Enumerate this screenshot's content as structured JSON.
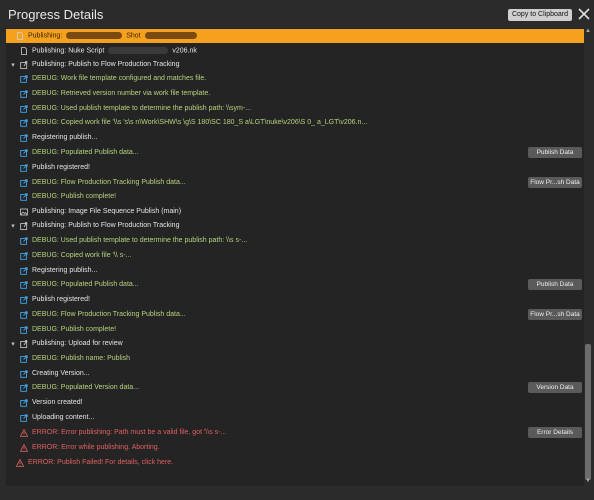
{
  "window": {
    "title": "Progress Details",
    "copy_label": "Copy to Clipboard"
  },
  "rows": [
    {
      "label": "Publishing:",
      "label2": "Shot",
      "style": "highlight",
      "icon": "doc-icon"
    },
    {
      "label": "Publishing: Nuke Script",
      "label2": "v206.nk",
      "style": "white",
      "icon": "doc-icon"
    },
    {
      "label": "Publishing: Publish to Flow Production Tracking",
      "style": "white",
      "icon": "upload-icon",
      "expand": "▾"
    },
    {
      "label": "DEBUG: Work file template configured and matches file.",
      "style": "green",
      "icon": "external-link-icon"
    },
    {
      "label": "DEBUG: Retrieved version number via work file template.",
      "style": "green",
      "icon": "external-link-icon"
    },
    {
      "label": "DEBUG: Used publish template to determine the publish path: \\\\sym-...",
      "style": "green",
      "icon": "external-link-icon"
    },
    {
      "label": "DEBUG: Copied work file '\\\\s    's\\s    n\\Work\\SHW\\s                    \\g\\S    180\\SC    180_S        a\\LGT\\nuke\\v206\\S    0_    a_LGT\\v206.n...",
      "style": "green",
      "icon": "external-link-icon"
    },
    {
      "label": "Registering publish...",
      "style": "white",
      "icon": "external-link-icon"
    },
    {
      "label": "DEBUG: Populated Publish data...",
      "style": "green",
      "icon": "external-link-icon",
      "button": "Publish Data"
    },
    {
      "label": "Publish registered!",
      "style": "white",
      "icon": "external-link-icon"
    },
    {
      "label": "DEBUG: Flow Production Tracking Publish data...",
      "style": "green",
      "icon": "external-link-icon",
      "button": "Flow Pr...sh Data"
    },
    {
      "label": "DEBUG: Publish complete!",
      "style": "green",
      "icon": "external-link-icon"
    },
    {
      "label": "Publishing: Image File Sequence Publish (main)",
      "style": "white",
      "icon": "image-icon"
    },
    {
      "label": "Publishing: Publish to Flow Production Tracking",
      "style": "white",
      "icon": "upload-icon",
      "expand": "▾"
    },
    {
      "label": "DEBUG: Used publish template to determine the publish path: \\\\s    s-...",
      "style": "green",
      "icon": "external-link-icon"
    },
    {
      "label": "DEBUG: Copied work file '\\\\     s-...",
      "style": "green",
      "icon": "external-link-icon"
    },
    {
      "label": "Registering publish...",
      "style": "white",
      "icon": "external-link-icon"
    },
    {
      "label": "DEBUG: Populated Publish data...",
      "style": "green",
      "icon": "external-link-icon",
      "button": "Publish Data"
    },
    {
      "label": "Publish registered!",
      "style": "white",
      "icon": "external-link-icon"
    },
    {
      "label": "DEBUG: Flow Production Tracking Publish data...",
      "style": "green",
      "icon": "external-link-icon",
      "button": "Flow Pr...sh Data"
    },
    {
      "label": "DEBUG: Publish complete!",
      "style": "green",
      "icon": "external-link-icon"
    },
    {
      "label": "Publishing: Upload for review",
      "style": "white",
      "icon": "upload-icon",
      "expand": "▾"
    },
    {
      "label": "DEBUG: Publish name: Publish",
      "style": "green",
      "icon": "external-link-icon"
    },
    {
      "label": "Creating Version...",
      "style": "white",
      "icon": "external-link-icon"
    },
    {
      "label": "DEBUG: Populated Version data...",
      "style": "green",
      "icon": "external-link-icon",
      "button": "Version Data"
    },
    {
      "label": "Version created!",
      "style": "white",
      "icon": "external-link-icon"
    },
    {
      "label": "Uploading content...",
      "style": "white",
      "icon": "external-link-icon"
    },
    {
      "label": "ERROR: Error publishing: Path must be a valid file, got '\\\\s    s-...",
      "style": "red",
      "icon": "warning-icon",
      "button": "Error Details"
    },
    {
      "label": "ERROR: Error while publishing. Aborting.",
      "style": "red",
      "icon": "warning-icon"
    },
    {
      "label": "ERROR: Publish Failed! For details, click here.",
      "style": "red",
      "icon": "warning-icon"
    }
  ]
}
